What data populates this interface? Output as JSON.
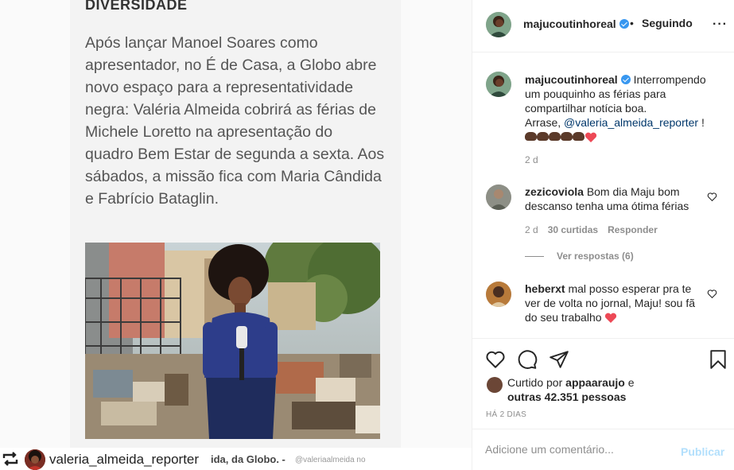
{
  "post_image": {
    "heading": "DIVERSIDADE",
    "body_lines": [
      "Após lançar Manoel Soares como",
      "apresentador, no É de Casa, a Globo abre",
      "novo espaço para a representatividade",
      "negra: Valéria Almeida cobrirá as férias de",
      "Michele Loretto na apresentação do",
      "quadro Bem Estar de segunda a sexta. Aos",
      "sábados, a missão fica com Maria Cândida",
      "e Fabrício Bataglin."
    ],
    "repost_user": "valeria_almeida_reporter",
    "caption_fragment": "ida, da Globo. -",
    "caption_handle": "@valeriaalmeida no"
  },
  "header": {
    "username": "majucoutinhoreal",
    "dot": "•",
    "follow_label": "Seguindo",
    "more": "···"
  },
  "caption": {
    "username": "majucoutinhoreal",
    "text_1": "Interrompendo um pouquinho as férias para compartilhar notícia boa.",
    "text_2": "Arrase, ",
    "mention": "@valeria_almeida_reporter",
    "text_3": " !",
    "age": "2 d"
  },
  "comments": [
    {
      "username": "zezicoviola",
      "text": "Bom dia Maju bom descanso tenha uma ótima férias",
      "age": "2 d",
      "likes": "30 curtidas",
      "reply": "Responder",
      "view_replies": "Ver respostas (6)"
    },
    {
      "username": "heberxt",
      "text": "mal posso esperar pra te ver de volta no jornal, Maju! sou fã do seu trabalho"
    }
  ],
  "likes": {
    "prefix": "Curtido por ",
    "user": "appaaraujo",
    "joiner": " e",
    "others": "outras 42.351 pessoas"
  },
  "timestamp": "HÁ 2 DIAS",
  "add_comment": {
    "placeholder": "Adicione um comentário...",
    "publish_label": "Publicar"
  },
  "colors": {
    "verified": "#3897f0",
    "mention": "#00376b",
    "publish_disabled": "#b2dffc",
    "heart": "#ed4956"
  }
}
